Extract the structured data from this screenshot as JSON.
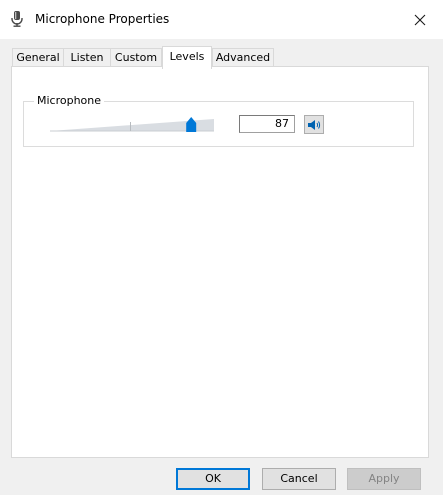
{
  "window": {
    "title": "Microphone Properties",
    "icon": "microphone-icon",
    "close_icon": "close-icon"
  },
  "tabs": [
    {
      "label": "General",
      "active": false
    },
    {
      "label": "Listen",
      "active": false
    },
    {
      "label": "Custom",
      "active": false
    },
    {
      "label": "Levels",
      "active": true
    },
    {
      "label": "Advanced",
      "active": false
    }
  ],
  "levels": {
    "group_title": "Microphone",
    "level_value": "87",
    "slider_level_percent": 87,
    "speaker_icon": "speaker-icon",
    "accent_color": "#0078d7"
  },
  "buttons": {
    "ok_label": "OK",
    "cancel_label": "Cancel",
    "apply_label": "Apply"
  }
}
